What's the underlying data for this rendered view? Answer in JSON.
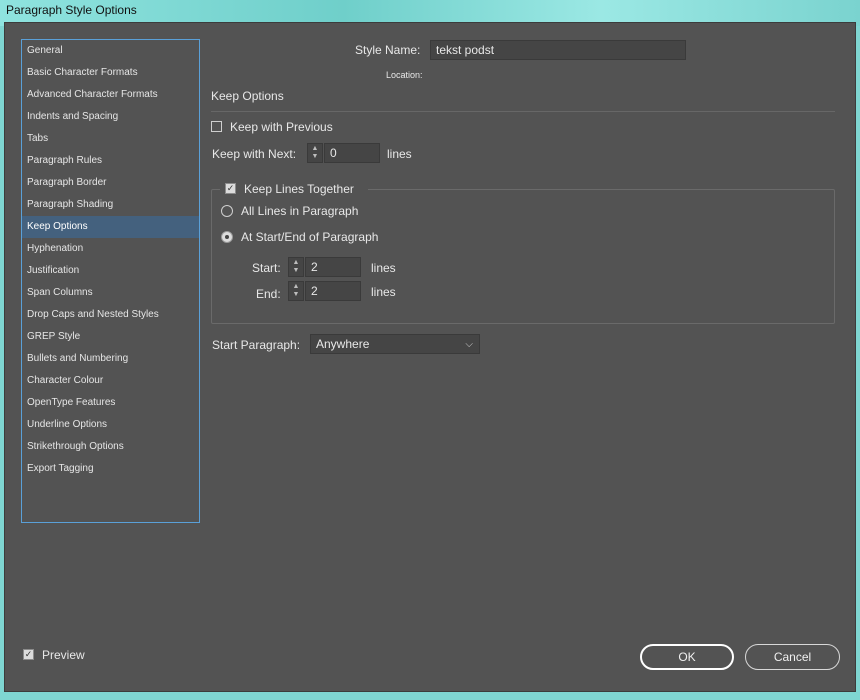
{
  "window": {
    "title": "Paragraph Style Options"
  },
  "sidebar": {
    "items": [
      {
        "label": "General"
      },
      {
        "label": "Basic Character Formats"
      },
      {
        "label": "Advanced Character Formats"
      },
      {
        "label": "Indents and Spacing"
      },
      {
        "label": "Tabs"
      },
      {
        "label": "Paragraph Rules"
      },
      {
        "label": "Paragraph Border"
      },
      {
        "label": "Paragraph Shading"
      },
      {
        "label": "Keep Options",
        "active": true
      },
      {
        "label": "Hyphenation"
      },
      {
        "label": "Justification"
      },
      {
        "label": "Span Columns"
      },
      {
        "label": "Drop Caps and Nested Styles"
      },
      {
        "label": "GREP Style"
      },
      {
        "label": "Bullets and Numbering"
      },
      {
        "label": "Character Colour"
      },
      {
        "label": "OpenType Features"
      },
      {
        "label": "Underline Options"
      },
      {
        "label": "Strikethrough Options"
      },
      {
        "label": "Export Tagging"
      }
    ]
  },
  "header": {
    "style_name_label": "Style Name:",
    "style_name_value": "tekst podst",
    "location_label": "Location:"
  },
  "keep_options": {
    "section_title": "Keep Options",
    "keep_with_previous_label": "Keep with Previous",
    "keep_with_previous_checked": false,
    "keep_with_next_label": "Keep with Next:",
    "keep_with_next_value": "0",
    "keep_with_next_unit": "lines",
    "keep_lines_together_label": "Keep Lines Together",
    "keep_lines_together_checked": true,
    "all_lines_label": "All Lines in Paragraph",
    "at_start_end_label": "At Start/End of Paragraph",
    "start_label": "Start:",
    "start_value": "2",
    "start_unit": "lines",
    "end_label": "End:",
    "end_value": "2",
    "end_unit": "lines",
    "start_paragraph_label": "Start Paragraph:",
    "start_paragraph_value": "Anywhere"
  },
  "footer": {
    "preview_label": "Preview",
    "preview_checked": true,
    "ok_label": "OK",
    "cancel_label": "Cancel"
  },
  "icons": {
    "check": "✓",
    "spin_up": "▲",
    "spin_down": "▼",
    "dropdown": "⌵"
  }
}
